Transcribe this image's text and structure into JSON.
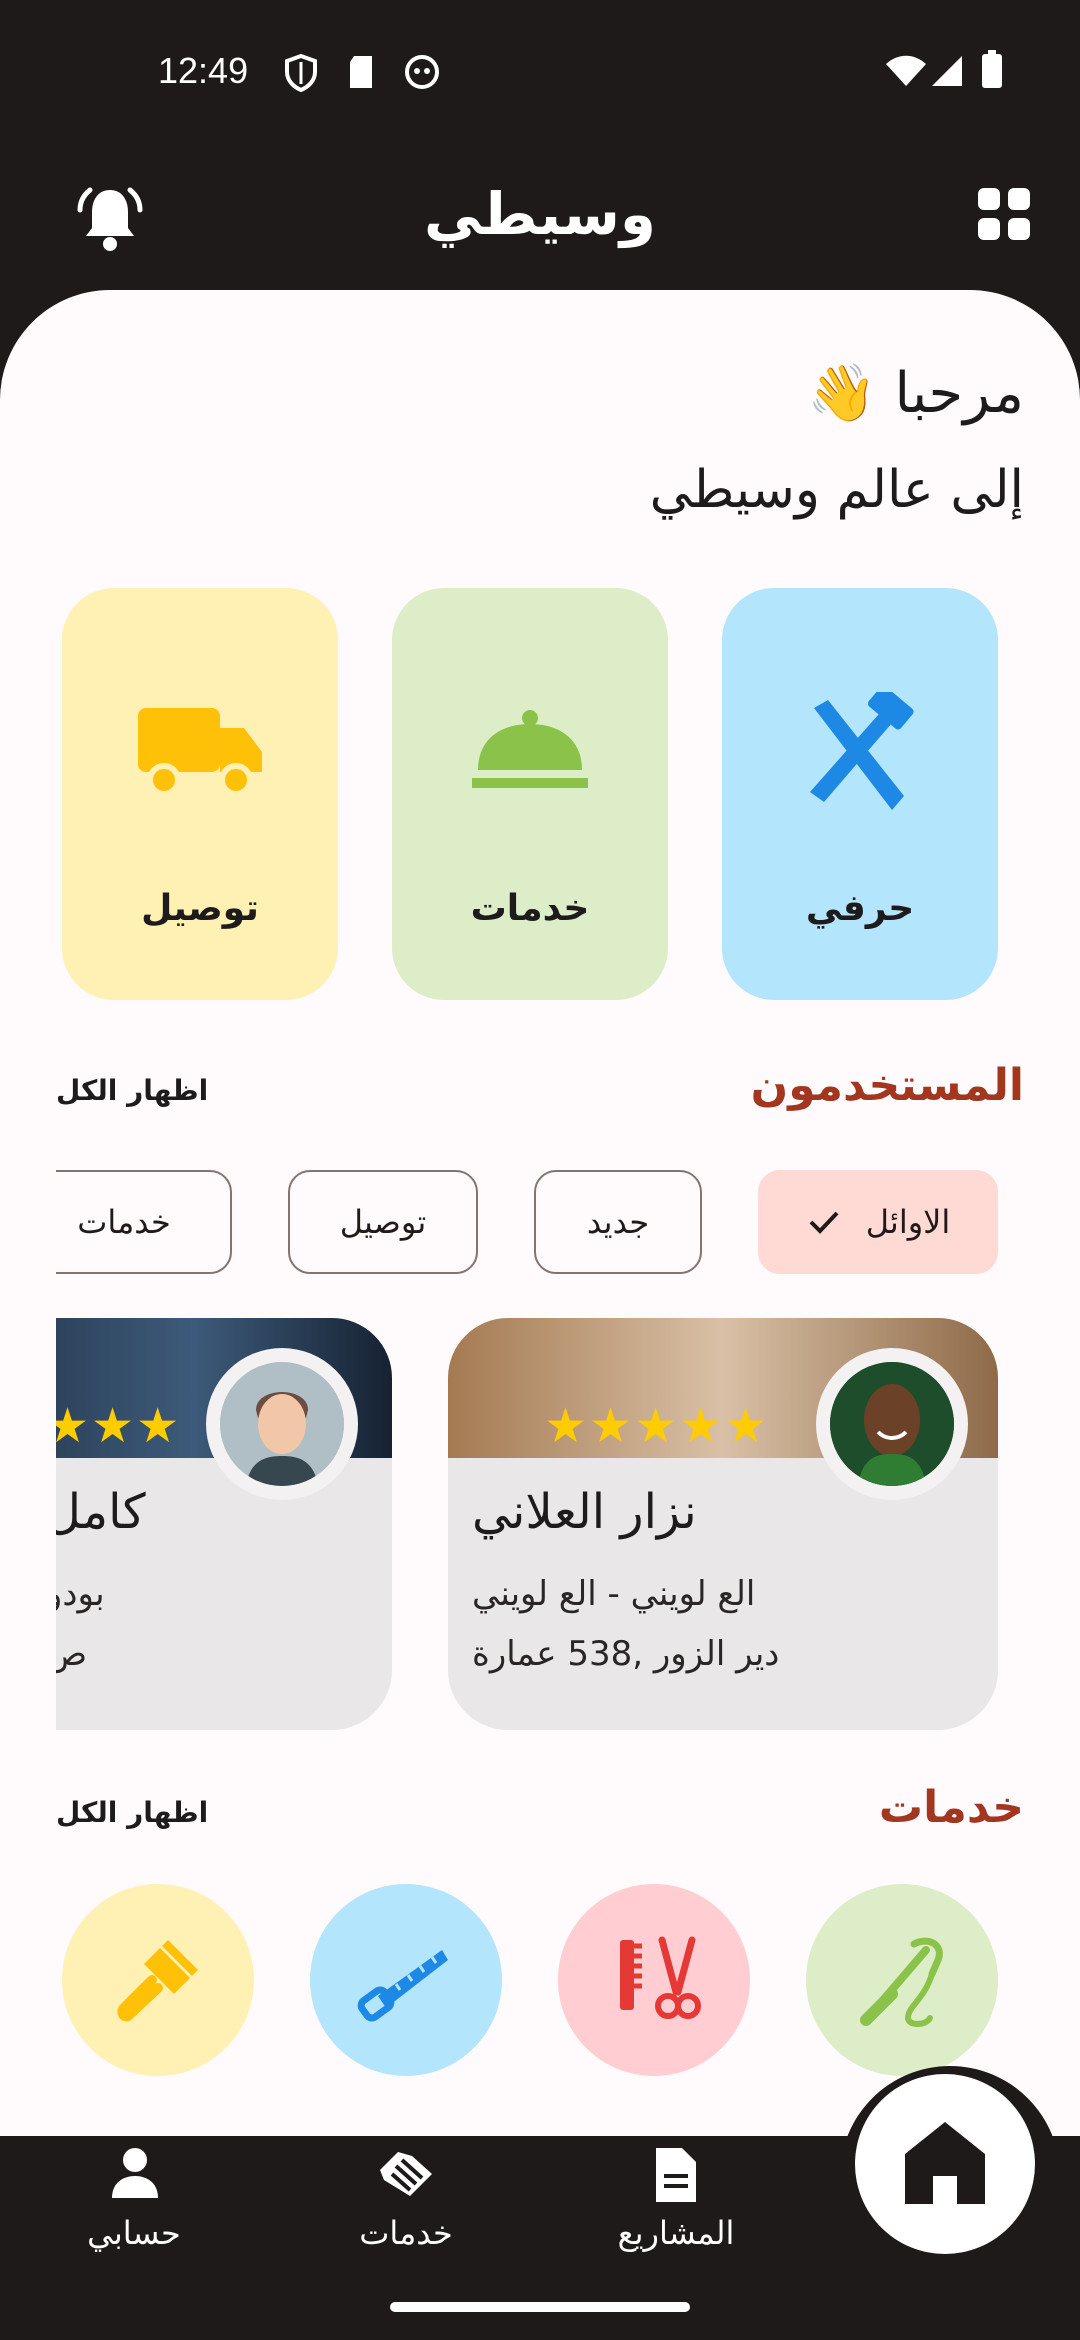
{
  "status_bar": {
    "time": "12:49"
  },
  "app_bar": {
    "title": "وسيطي",
    "left_icon": "bell-icon",
    "right_icon": "grid-icon"
  },
  "greeting": {
    "line1": "مرحبا 👋",
    "line2": "إلى عالم وسيطي"
  },
  "categories": [
    {
      "label": "حرفي",
      "icon": "tools-icon",
      "bg": "#b3e5fc",
      "icon_color": "#1e88e5"
    },
    {
      "label": "خدمات",
      "icon": "cloche-icon",
      "bg": "#dcedc8",
      "icon_color": "#8bc34a"
    },
    {
      "label": "توصيل",
      "icon": "truck-icon",
      "bg": "#fff0b3",
      "icon_color": "#ffc107"
    }
  ],
  "users_section": {
    "title": "المستخدمون",
    "show_all": "اظهار الكل"
  },
  "filter_chips": [
    {
      "label": "الاوائل",
      "selected": true
    },
    {
      "label": "جديد",
      "selected": false
    },
    {
      "label": "توصيل",
      "selected": false
    },
    {
      "label": "خدمات",
      "selected": false
    }
  ],
  "users": [
    {
      "name": "نزار العلاني",
      "line1": "الع لويني - الع لويني",
      "line2": "دير الزور ,538 عمارة",
      "rating": 5
    },
    {
      "name": "كامل",
      "line1": "بودو",
      "line2": "ص",
      "rating": 3
    }
  ],
  "services_section": {
    "title": "خدمات",
    "show_all": "اظهار الكل"
  },
  "services": [
    {
      "icon": "sewing-machine-icon",
      "bg": "#dcedc8",
      "color": "#8bc34a"
    },
    {
      "icon": "barber-icon",
      "bg": "#ffcdd2",
      "color": "#e53935"
    },
    {
      "icon": "saw-icon",
      "bg": "#b3e5fc",
      "color": "#1e88e5"
    },
    {
      "icon": "paint-brush-icon",
      "bg": "#fff0b3",
      "color": "#ffc107"
    }
  ],
  "bottom_nav": [
    {
      "label": "حسابي",
      "icon": "person-icon"
    },
    {
      "label": "خدمات",
      "icon": "handshake-icon"
    },
    {
      "label": "المشاريع",
      "icon": "document-icon"
    }
  ],
  "home_button": {
    "icon": "home-icon"
  }
}
